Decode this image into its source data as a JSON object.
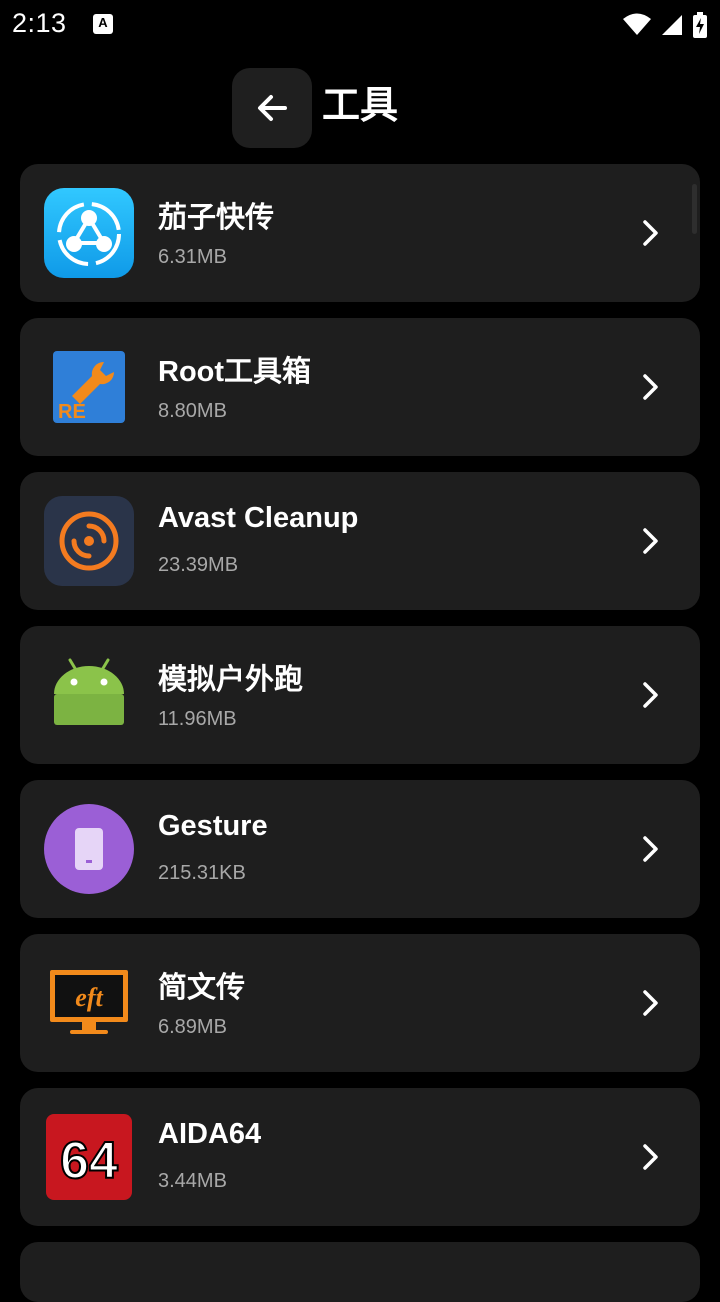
{
  "status_bar": {
    "time": "2:13",
    "notification_icon": "font-a-icon",
    "icons": [
      "wifi-icon",
      "cell-signal-icon",
      "battery-charging-icon"
    ]
  },
  "header": {
    "back_icon": "arrow-left-icon",
    "title": "工具"
  },
  "apps": [
    {
      "name": "茄子快传",
      "size": "6.31MB",
      "icon": "shareit-icon",
      "icon_color": "#1aa4f0"
    },
    {
      "name": "Root工具箱",
      "size": "8.80MB",
      "icon": "root-toolbox-icon",
      "icon_color": "#2f7fd8"
    },
    {
      "name": "Avast Cleanup",
      "size": "23.39MB",
      "icon": "avast-cleanup-icon",
      "icon_color": "#2a3449"
    },
    {
      "name": "模拟户外跑",
      "size": "11.96MB",
      "icon": "android-icon",
      "icon_color": "#8bc34a"
    },
    {
      "name": "Gesture",
      "size": "215.31KB",
      "icon": "gesture-icon",
      "icon_color": "#9b5fd6"
    },
    {
      "name": "简文传",
      "size": "6.89MB",
      "icon": "eft-monitor-icon",
      "icon_color": "#f28a1b"
    },
    {
      "name": "AIDA64",
      "size": "3.44MB",
      "icon": "aida64-icon",
      "icon_color": "#c8171f"
    }
  ],
  "colors": {
    "background": "#000000",
    "card": "#1e1e1e",
    "secondary_text": "#a8a8a8"
  }
}
